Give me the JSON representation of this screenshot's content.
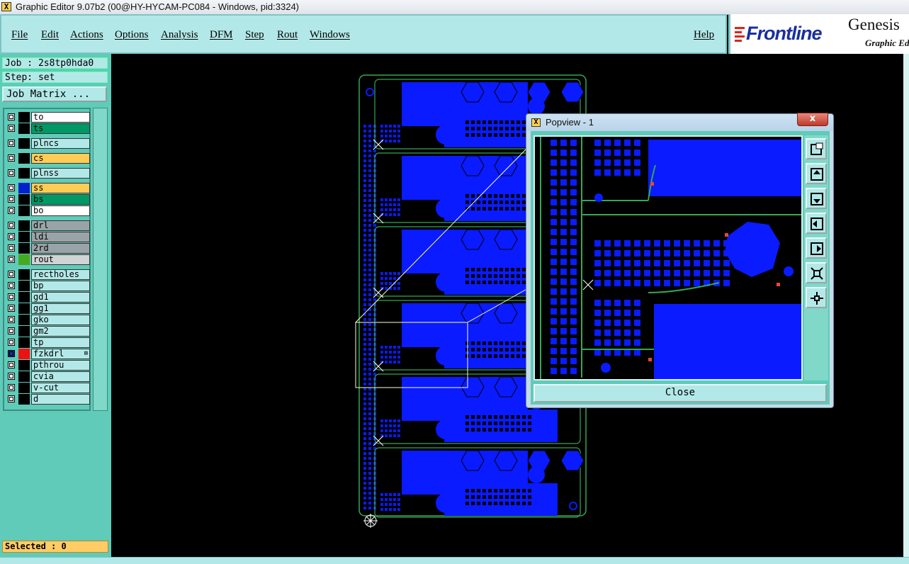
{
  "window": {
    "title": "Graphic Editor 9.07b2 (00@HY-HYCAM-PC084 - Windows, pid:3324)"
  },
  "menu": {
    "items": [
      "File",
      "Edit",
      "Actions",
      "Options",
      "Analysis",
      "DFM",
      "Step",
      "Rout",
      "Windows"
    ],
    "help": "Help"
  },
  "logo": {
    "brand": "Frontline",
    "product": "Genesis",
    "subtitle": "Graphic Ed"
  },
  "job": {
    "job_label": "Job : 2s8tp0hda0",
    "step_label": "Step: set",
    "matrix_button": "Job Matrix ..."
  },
  "layers": [
    {
      "name": "to",
      "color": "#ffffff",
      "swatch": "#000000"
    },
    {
      "name": "ts",
      "color": "#009966",
      "swatch": "#000000"
    },
    {
      "name": "plncs",
      "color": "#b3e8e8",
      "swatch": "#000000"
    },
    {
      "name": "cs",
      "color": "#ffcc55",
      "swatch": "#000000"
    },
    {
      "name": "plnss",
      "color": "#b3e8e8",
      "swatch": "#000000"
    },
    {
      "name": "ss",
      "color": "#ffcc55",
      "swatch": "#0022cc"
    },
    {
      "name": "bs",
      "color": "#009966",
      "swatch": "#000000"
    },
    {
      "name": "bo",
      "color": "#ffffff",
      "swatch": "#000000"
    },
    {
      "name": "drl",
      "color": "#9aa4a8",
      "swatch": "#000000"
    },
    {
      "name": "ldi",
      "color": "#9aa4a8",
      "swatch": "#000000"
    },
    {
      "name": "2rd",
      "color": "#9aa4a8",
      "swatch": "#000000"
    },
    {
      "name": "rout",
      "color": "#d0d4d4",
      "swatch": "#44aa22"
    },
    {
      "name": "rectholes",
      "color": "#b3e8e8",
      "swatch": "#000000"
    },
    {
      "name": "bp",
      "color": "#b3e8e8",
      "swatch": "#000000"
    },
    {
      "name": "gd1",
      "color": "#b3e8e8",
      "swatch": "#000000"
    },
    {
      "name": "gg1",
      "color": "#b3e8e8",
      "swatch": "#000000"
    },
    {
      "name": "gko",
      "color": "#b3e8e8",
      "swatch": "#000000"
    },
    {
      "name": "gm2",
      "color": "#b3e8e8",
      "swatch": "#000000"
    },
    {
      "name": "tp",
      "color": "#b3e8e8",
      "swatch": "#000000"
    },
    {
      "name": "fzkdrl",
      "color": "#b3e8e8",
      "swatch": "#ee1111",
      "active": true
    },
    {
      "name": "pthrou",
      "color": "#b3e8e8",
      "swatch": "#000000"
    },
    {
      "name": "cvia",
      "color": "#b3e8e8",
      "swatch": "#000000"
    },
    {
      "name": "v-cut",
      "color": "#b3e8e8",
      "swatch": "#000000"
    },
    {
      "name": "d",
      "color": "#b3e8e8",
      "swatch": "#000000"
    }
  ],
  "status": {
    "selected": "Selected : 0"
  },
  "popview": {
    "title": "Popview - 1",
    "close_x": "x",
    "close_button": "Close"
  },
  "colors": {
    "copper": "#0a1bff",
    "board": "#000000",
    "outline": "#34a853",
    "panel": "#5fcbb8",
    "menu": "#b3e8e8"
  }
}
